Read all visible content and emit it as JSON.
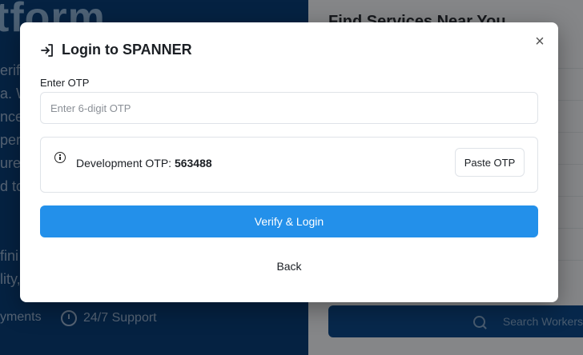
{
  "background": {
    "hero_title": "tform",
    "hero_lines": [
      "erif",
      "a. W",
      "nce",
      "per",
      "ure",
      "d to",
      "",
      "",
      "fini",
      "lity,"
    ],
    "features": [
      {
        "icon": "card-icon",
        "label": "yments"
      },
      {
        "icon": "clock-icon",
        "label": "24/7 Support"
      }
    ],
    "right_panel_title": "Find Services Near You",
    "search_placeholder": "Search Workers"
  },
  "modal": {
    "title": "Login to SPANNER",
    "title_icon": "login-arrow-icon",
    "close_icon": "close-icon",
    "close_symbol": "×",
    "otp_label": "Enter OTP",
    "otp_placeholder": "Enter 6-digit OTP",
    "otp_value": "",
    "dev_label": "Development OTP: ",
    "dev_otp": "563488",
    "paste_label": "Paste OTP",
    "verify_label": "Verify & Login",
    "back_label": "Back"
  },
  "colors": {
    "primary": "#2390ea",
    "background_left": "#0a3f78",
    "overlay": "rgba(0,0,0,0.45)"
  }
}
